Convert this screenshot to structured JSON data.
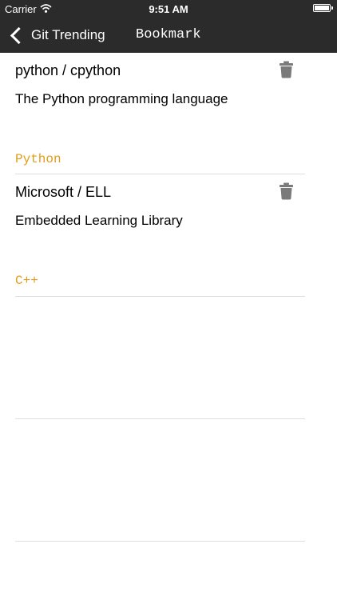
{
  "status_bar": {
    "carrier": "Carrier",
    "time": "9:51 AM"
  },
  "nav": {
    "back_label": "Git Trending",
    "title": "Bookmark"
  },
  "bookmarks": [
    {
      "name": "python / cpython",
      "description": "The Python programming language",
      "language": "Python"
    },
    {
      "name": "Microsoft / ELL",
      "description": "Embedded Learning Library",
      "language": "C++"
    }
  ],
  "colors": {
    "nav_background": "#2b2b2b",
    "language_accent": "#e49b18",
    "divider": "#dedede",
    "icon_gray": "#7a7a7a"
  },
  "icons": {
    "back": "chevron-left-icon",
    "delete": "trash-icon"
  }
}
